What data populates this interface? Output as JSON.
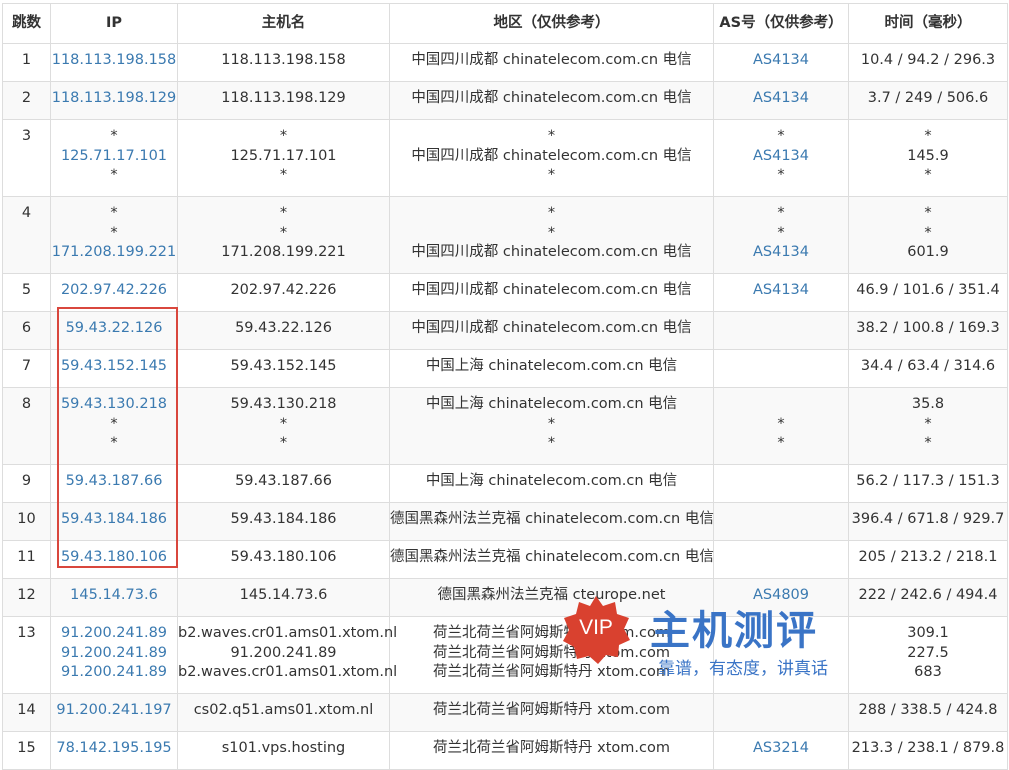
{
  "headers": {
    "hop": "跳数",
    "ip": "IP",
    "host": "主机名",
    "region": "地区（仅供参考）",
    "as": "AS号（仅供参考）",
    "time": "时间（毫秒）"
  },
  "rows": [
    {
      "hop": "1",
      "ip": [
        "118.113.198.158"
      ],
      "host": [
        "118.113.198.158"
      ],
      "region": [
        "中国四川成都 chinatelecom.com.cn 电信"
      ],
      "as": [
        "AS4134"
      ],
      "time": [
        "10.4 / 94.2 / 296.3"
      ]
    },
    {
      "hop": "2",
      "ip": [
        "118.113.198.129"
      ],
      "host": [
        "118.113.198.129"
      ],
      "region": [
        "中国四川成都 chinatelecom.com.cn 电信"
      ],
      "as": [
        "AS4134"
      ],
      "time": [
        "3.7 / 249 / 506.6"
      ]
    },
    {
      "hop": "3",
      "ip": [
        "*",
        "125.71.17.101",
        "*"
      ],
      "host": [
        "*",
        "125.71.17.101",
        "*"
      ],
      "region": [
        "*",
        "中国四川成都 chinatelecom.com.cn 电信",
        "*"
      ],
      "as": [
        "*",
        "AS4134",
        "*"
      ],
      "time": [
        "*",
        "145.9",
        "*"
      ]
    },
    {
      "hop": "4",
      "ip": [
        "*",
        "*",
        "171.208.199.221"
      ],
      "host": [
        "*",
        "*",
        "171.208.199.221"
      ],
      "region": [
        "*",
        "*",
        "中国四川成都 chinatelecom.com.cn 电信"
      ],
      "as": [
        "*",
        "*",
        "AS4134"
      ],
      "time": [
        "*",
        "*",
        "601.9"
      ]
    },
    {
      "hop": "5",
      "ip": [
        "202.97.42.226"
      ],
      "host": [
        "202.97.42.226"
      ],
      "region": [
        "中国四川成都 chinatelecom.com.cn 电信"
      ],
      "as": [
        "AS4134"
      ],
      "time": [
        "46.9 / 101.6 / 351.4"
      ]
    },
    {
      "hop": "6",
      "ip": [
        "59.43.22.126"
      ],
      "host": [
        "59.43.22.126"
      ],
      "region": [
        "中国四川成都 chinatelecom.com.cn 电信"
      ],
      "as": [
        ""
      ],
      "time": [
        "38.2 / 100.8 / 169.3"
      ]
    },
    {
      "hop": "7",
      "ip": [
        "59.43.152.145"
      ],
      "host": [
        "59.43.152.145"
      ],
      "region": [
        "中国上海 chinatelecom.com.cn 电信"
      ],
      "as": [
        ""
      ],
      "time": [
        "34.4 / 63.4 / 314.6"
      ]
    },
    {
      "hop": "8",
      "ip": [
        "59.43.130.218",
        "*",
        "*"
      ],
      "host": [
        "59.43.130.218",
        "*",
        "*"
      ],
      "region": [
        "中国上海 chinatelecom.com.cn 电信",
        "*",
        "*"
      ],
      "as": [
        "",
        "*",
        "*"
      ],
      "time": [
        "35.8",
        "*",
        "*"
      ]
    },
    {
      "hop": "9",
      "ip": [
        "59.43.187.66"
      ],
      "host": [
        "59.43.187.66"
      ],
      "region": [
        "中国上海 chinatelecom.com.cn 电信"
      ],
      "as": [
        ""
      ],
      "time": [
        "56.2 / 117.3 / 151.3"
      ]
    },
    {
      "hop": "10",
      "ip": [
        "59.43.184.186"
      ],
      "host": [
        "59.43.184.186"
      ],
      "region": [
        "德国黑森州法兰克福 chinatelecom.com.cn 电信"
      ],
      "as": [
        ""
      ],
      "time": [
        "396.4 / 671.8 / 929.7"
      ]
    },
    {
      "hop": "11",
      "ip": [
        "59.43.180.106"
      ],
      "host": [
        "59.43.180.106"
      ],
      "region": [
        "德国黑森州法兰克福 chinatelecom.com.cn 电信"
      ],
      "as": [
        ""
      ],
      "time": [
        "205 / 213.2 / 218.1"
      ]
    },
    {
      "hop": "12",
      "ip": [
        "145.14.73.6"
      ],
      "host": [
        "145.14.73.6"
      ],
      "region": [
        "德国黑森州法兰克福 cteurope.net"
      ],
      "as": [
        "AS4809"
      ],
      "time": [
        "222 / 242.6 / 494.4"
      ]
    },
    {
      "hop": "13",
      "ip": [
        "91.200.241.89",
        "91.200.241.89",
        "91.200.241.89"
      ],
      "host": [
        "b2.waves.cr01.ams01.xtom.nl",
        "91.200.241.89",
        "b2.waves.cr01.ams01.xtom.nl"
      ],
      "region": [
        "荷兰北荷兰省阿姆斯特丹 xtom.com",
        "荷兰北荷兰省阿姆斯特丹 xtom.com",
        "荷兰北荷兰省阿姆斯特丹 xtom.com"
      ],
      "as": [
        "",
        "",
        ""
      ],
      "time": [
        "309.1",
        "227.5",
        "683"
      ]
    },
    {
      "hop": "14",
      "ip": [
        "91.200.241.197"
      ],
      "host": [
        "cs02.q51.ams01.xtom.nl"
      ],
      "region": [
        "荷兰北荷兰省阿姆斯特丹 xtom.com"
      ],
      "as": [
        ""
      ],
      "time": [
        "288 / 338.5 / 424.8"
      ]
    },
    {
      "hop": "15",
      "ip": [
        "78.142.195.195"
      ],
      "host": [
        "s101.vps.hosting"
      ],
      "region": [
        "荷兰北荷兰省阿姆斯特丹 xtom.com"
      ],
      "as": [
        "AS3214"
      ],
      "time": [
        "213.3 / 238.1 / 879.8"
      ]
    }
  ],
  "watermark": {
    "badge": "VIP",
    "brand": "主机测评",
    "slogan": "靠谱，有态度，讲真话",
    "badge_color": "#d9412f",
    "brand_color": "#3a74c6"
  },
  "colors": {
    "link": "#3b7ab0",
    "highlight_border": "#d9473d",
    "grid": "#dddddd",
    "alt_row": "#f9f9f9"
  }
}
